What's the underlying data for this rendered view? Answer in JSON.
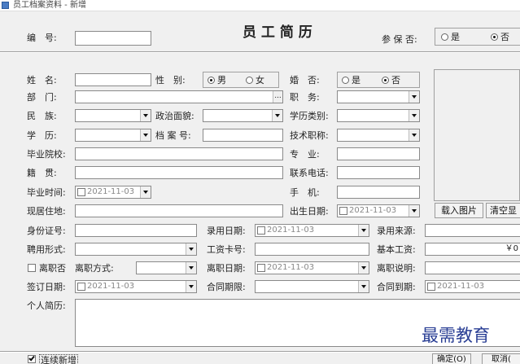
{
  "window": {
    "title": "员工档案资料 - 新增"
  },
  "header": {
    "id_label": "编　号:",
    "id_value": "",
    "form_title": "员 工 简 历",
    "insured_label": "参 保 否:",
    "yes": "是",
    "no": "否"
  },
  "fields": {
    "name": "姓　名:",
    "gender": "性　别:",
    "male": "男",
    "female": "女",
    "marital": "婚　否:",
    "yes": "是",
    "no": "否",
    "department": "部　门:",
    "dept_btn": "...",
    "position": "职　务:",
    "ethnicity": "民　族:",
    "political": "政治面貌:",
    "edu_type": "学历类别:",
    "education": "学　历:",
    "archive_no": "档 案 号:",
    "tech_title": "技术职称:",
    "school": "毕业院校:",
    "major": "专　业:",
    "native": "籍　贯:",
    "phone": "联系电话:",
    "grad_time": "毕业时间:",
    "mobile": "手　机:",
    "address": "现居住地:",
    "birth_date": "出生日期:",
    "id_card": "身份证号:",
    "hire_date": "录用日期:",
    "hire_source": "录用来源:",
    "employ_form": "聘用形式:",
    "salary_card": "工资卡号:",
    "base_salary": "基本工资:",
    "base_salary_value": "￥0",
    "resigned": "离职否",
    "resign_mode": "离职方式:",
    "resign_date": "离职日期:",
    "resign_note": "离职说明:",
    "sign_date": "签订日期:",
    "contract_term": "合同期限:",
    "contract_end": "合同到期:",
    "resume": "个人简历:",
    "date_value": "2021-11-03"
  },
  "photo": {
    "load_btn": "载入图片",
    "clear_btn": "清空显"
  },
  "footer": {
    "continue_add": "连续新增",
    "confirm": "确定(O)",
    "cancel": "取消("
  },
  "watermark": "最需教育"
}
